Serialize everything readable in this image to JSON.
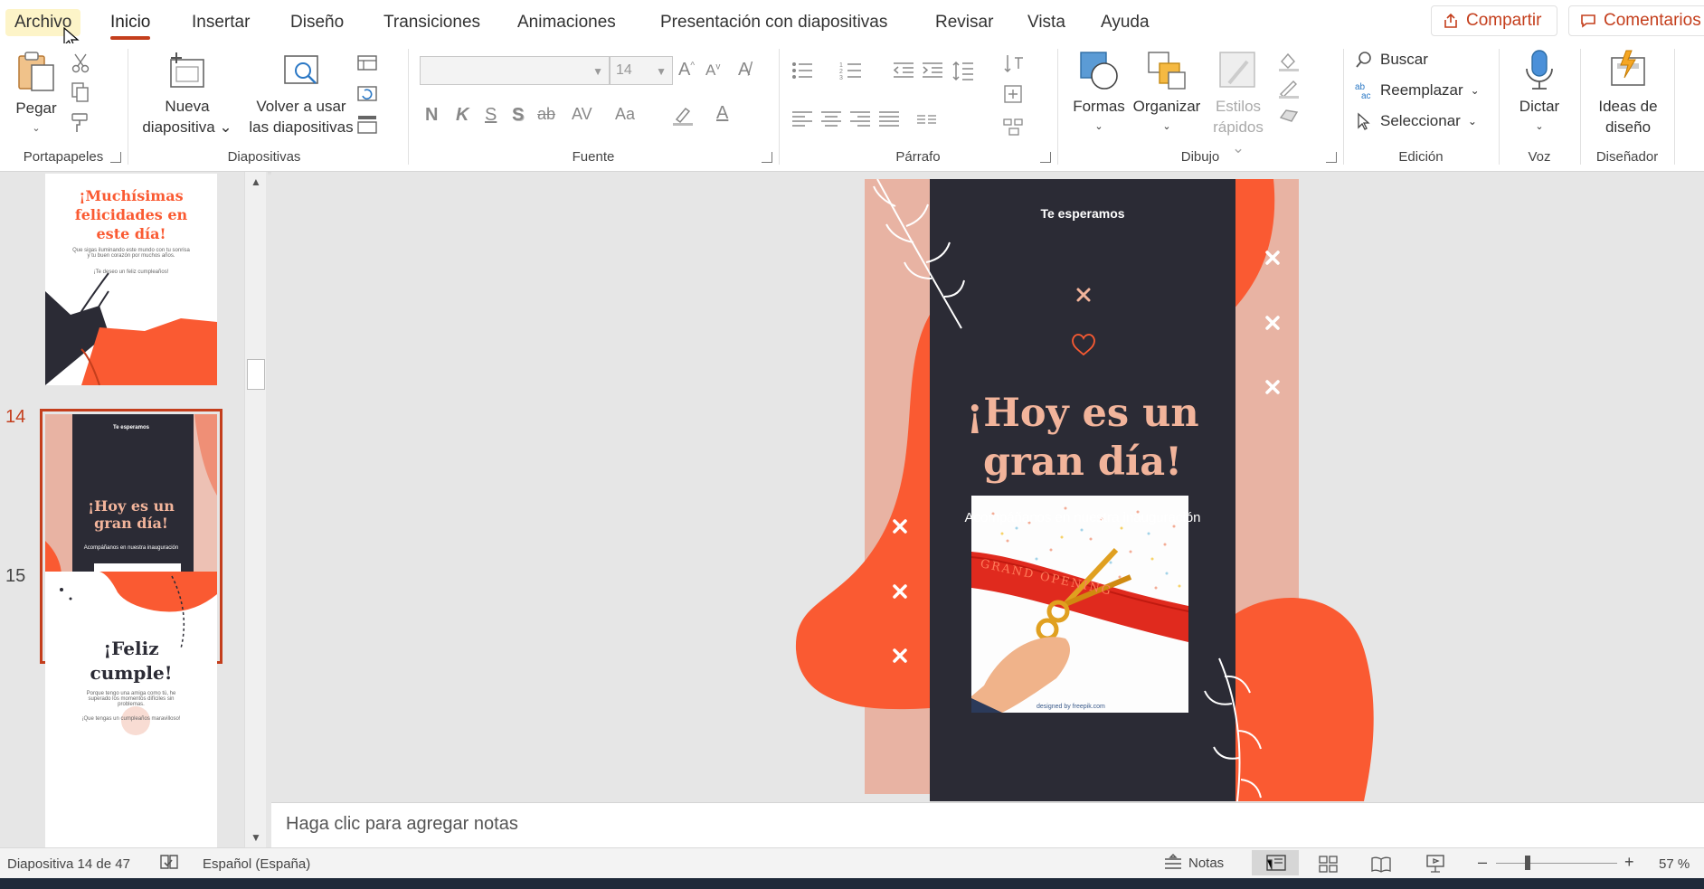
{
  "tabs": {
    "file": "Archivo",
    "home": "Inicio",
    "insert": "Insertar",
    "design": "Diseño",
    "transitions": "Transiciones",
    "animations": "Animaciones",
    "slideshow": "Presentación con diapositivas",
    "review": "Revisar",
    "view": "Vista",
    "help": "Ayuda"
  },
  "header": {
    "share": "Compartir",
    "comments": "Comentarios"
  },
  "ribbon": {
    "clipboard": {
      "paste": "Pegar",
      "label": "Portapapeles"
    },
    "slides": {
      "new_slide_1": "Nueva",
      "new_slide_2": "diapositiva",
      "reuse_1": "Volver a usar",
      "reuse_2": "las diapositivas",
      "label": "Diapositivas"
    },
    "font": {
      "font_name": "",
      "font_size": "14",
      "bold": "N",
      "italic": "K",
      "underline": "S",
      "shadow": "S",
      "strike": "ab",
      "spacing": "AV",
      "case": "Aa",
      "label": "Fuente"
    },
    "paragraph": {
      "label": "Párrafo"
    },
    "drawing": {
      "shapes": "Formas",
      "arrange": "Organizar",
      "quick_styles_1": "Estilos",
      "quick_styles_2": "rápidos",
      "label": "Dibujo"
    },
    "editing": {
      "find": "Buscar",
      "replace": "Reemplazar",
      "select": "Seleccionar",
      "label": "Edición"
    },
    "voice": {
      "dictate": "Dictar",
      "label": "Voz"
    },
    "designer": {
      "ideas_1": "Ideas de",
      "ideas_2": "diseño",
      "label": "Diseñador"
    }
  },
  "thumbnails": [
    {
      "number": "",
      "title": "¡Muchísimas felicidades en este día!",
      "body": "Que sigas iluminando este mundo con tu sonrisa y tu buen corazón por muchos años.",
      "footer": "¡Te deseo un feliz cumpleaños!"
    },
    {
      "number": "14",
      "header": "Te esperamos",
      "title": "¡Hoy es un gran día!",
      "subtitle": "Acompáñanos en nuestra inauguración"
    },
    {
      "number": "15",
      "title": "¡Feliz cumple!",
      "body": "Porque tengo una amiga como tú, he superado los momentos difíciles sin problemas.",
      "footer": "¡Que tengas un cumpleaños maravilloso!"
    }
  ],
  "slide": {
    "header": "Te esperamos",
    "title_line1": "¡Hoy es un",
    "title_line2": "gran día!",
    "subtitle": "Acompáñanos en nuestra inauguración",
    "ribbon_text": "GRAND OPENING",
    "credit": "designed by freepik.com"
  },
  "notes_placeholder": "Haga clic para agregar notas",
  "status": {
    "slide_counter": "Diapositiva 14 de 47",
    "language": "Español (España)",
    "notes": "Notas",
    "zoom": "57 %"
  },
  "colors": {
    "accent": "#c43e1c",
    "slide_dark": "#2b2b35",
    "slide_pink": "#e8b3a3",
    "slide_orange": "#fa5a32",
    "title_peach": "#f2b49b"
  }
}
